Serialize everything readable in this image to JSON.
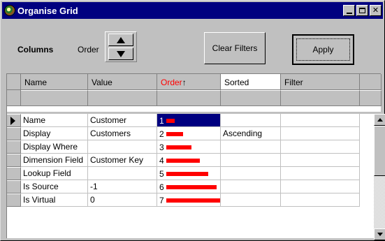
{
  "window": {
    "title": "Organise Grid",
    "app_icon": "globe-icon"
  },
  "toolbar": {
    "columns_label": "Columns",
    "order_label": "Order",
    "clear_filters_label": "Clear Filters",
    "apply_label": "Apply"
  },
  "grid": {
    "headers": [
      "Name",
      "Value",
      "Order",
      "Sorted",
      "Filter"
    ],
    "order_sort_icon": "↑",
    "accent_color": "#ff0000",
    "selection_color": "#000080",
    "rows": [
      {
        "name": "Name",
        "value": "Customer",
        "order": "1",
        "order_level": 1,
        "sorted": "",
        "filter": ""
      },
      {
        "name": "Display",
        "value": "Customers",
        "order": "2",
        "order_level": 2,
        "sorted": "Ascending",
        "filter": ""
      },
      {
        "name": "Display Where",
        "value": "",
        "order": "3",
        "order_level": 3,
        "sorted": "",
        "filter": ""
      },
      {
        "name": "Dimension Field",
        "value": "Customer Key",
        "order": "4",
        "order_level": 4,
        "sorted": "",
        "filter": ""
      },
      {
        "name": "Lookup Field",
        "value": "",
        "order": "5",
        "order_level": 5,
        "sorted": "",
        "filter": ""
      },
      {
        "name": "Is Source",
        "value": "-1",
        "order": "6",
        "order_level": 6,
        "sorted": "",
        "filter": ""
      },
      {
        "name": "Is Virtual",
        "value": "0",
        "order": "7",
        "order_level": 7,
        "sorted": "",
        "filter": ""
      }
    ]
  }
}
